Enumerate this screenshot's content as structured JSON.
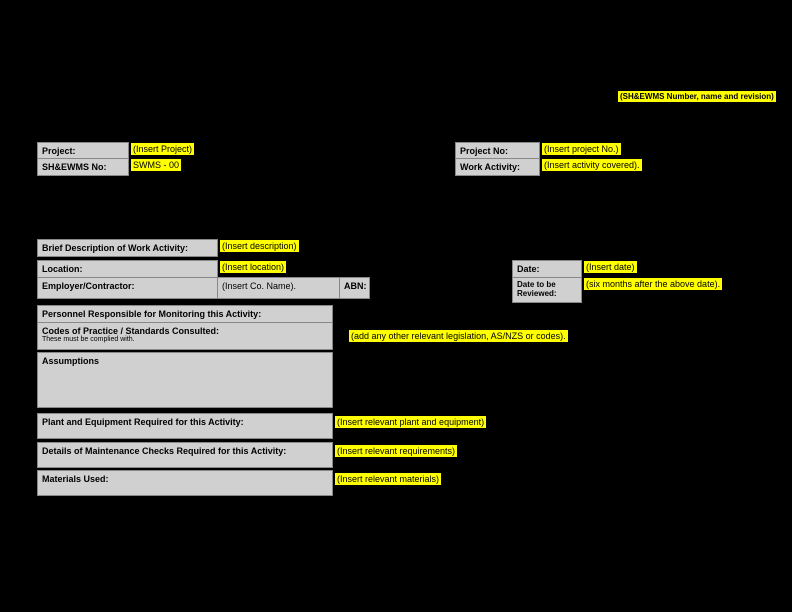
{
  "header": {
    "revision_note": "(SH&EWMS Number, name and revision)"
  },
  "project": {
    "label": "Project:",
    "value": "(Insert Project)",
    "no_label": "Project No:",
    "no_value": "(Insert project No.)"
  },
  "shewms": {
    "label": "SH&EWMS No:",
    "value": "SWMS - 00"
  },
  "work_activity": {
    "label": "Work Activity:",
    "value": "(Insert activity covered)."
  },
  "description": {
    "label": "Brief Description of Work Activity:",
    "value": "(Insert description)"
  },
  "location": {
    "label": "Location:",
    "value": "(Insert location)"
  },
  "date": {
    "label": "Date:",
    "value": "(Insert date)"
  },
  "employer": {
    "label": "Employer/Contractor:",
    "co_name": "(Insert Co. Name).",
    "abn_label": "ABN:"
  },
  "review": {
    "label": "Date to be Reviewed:",
    "value": "(six months after the above date)."
  },
  "personnel": {
    "label": "Personnel Responsible for Monitoring this Activity:"
  },
  "codes": {
    "label": "Codes of Practice / Standards Consulted:",
    "sublabel": "These must be complied with.",
    "value": "(add any other relevant legislation, AS/NZS or codes)."
  },
  "assumptions": {
    "label": "Assumptions"
  },
  "plant": {
    "label": "Plant and Equipment Required for this Activity:",
    "value": "(Insert relevant plant and equipment)"
  },
  "maintenance": {
    "label": "Details of Maintenance Checks Required for this Activity:",
    "value": "(Insert relevant requirements)"
  },
  "materials": {
    "label": "Materials Used:",
    "value": "(Insert relevant materials)"
  }
}
